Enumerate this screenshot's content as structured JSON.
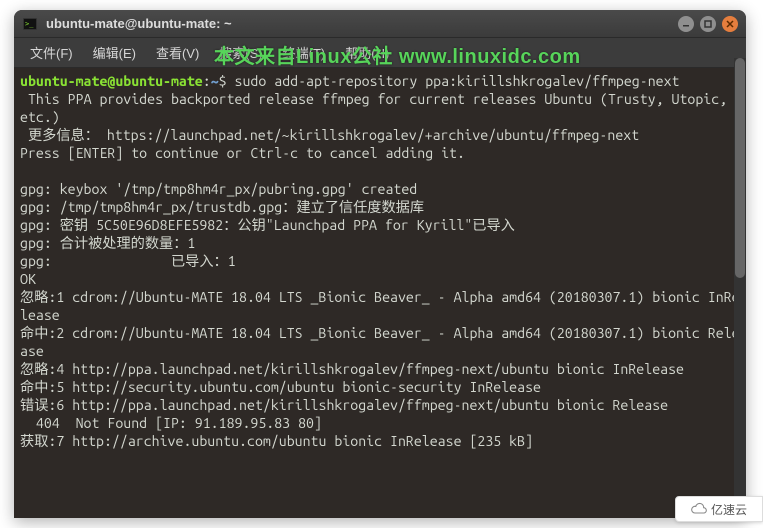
{
  "window": {
    "title": "ubuntu-mate@ubuntu-mate: ~"
  },
  "menubar": {
    "file": "文件(F)",
    "edit": "编辑(E)",
    "view": "查看(V)",
    "search": "搜索(S)",
    "terminal": "终端(T)",
    "help": "帮助(H)"
  },
  "watermark": "本文来自Linux公社 www.linuxidc.com",
  "prompt": {
    "user_host": "ubuntu-mate@ubuntu-mate",
    "colon": ":",
    "path": "~",
    "dollar": "$ "
  },
  "command": "sudo add-apt-repository ppa:kirillshkrogalev/ffmpeg-next",
  "output_lines": [
    " This PPA provides backported release ffmpeg for current releases Ubuntu (Trusty, Utopic, etc.)",
    " 更多信息： https://launchpad.net/~kirillshkrogalev/+archive/ubuntu/ffmpeg-next",
    "Press [ENTER] to continue or Ctrl-c to cancel adding it.",
    "",
    "gpg: keybox '/tmp/tmp8hm4r_px/pubring.gpg' created",
    "gpg: /tmp/tmp8hm4r_px/trustdb.gpg：建立了信任度数据库",
    "gpg: 密钥 5C50E96D8EFE5982：公钥\"Launchpad PPA for Kyrill\"已导入",
    "gpg: 合计被处理的数量：1",
    "gpg:               已导入：1",
    "OK",
    "忽略:1 cdrom://Ubuntu-MATE 18.04 LTS _Bionic Beaver_ - Alpha amd64 (20180307.1) bionic InRelease",
    "命中:2 cdrom://Ubuntu-MATE 18.04 LTS _Bionic Beaver_ - Alpha amd64 (20180307.1) bionic Release",
    "忽略:4 http://ppa.launchpad.net/kirillshkrogalev/ffmpeg-next/ubuntu bionic InRelease",
    "命中:5 http://security.ubuntu.com/ubuntu bionic-security InRelease",
    "错误:6 http://ppa.launchpad.net/kirillshkrogalev/ffmpeg-next/ubuntu bionic Release",
    "  404  Not Found [IP: 91.189.95.83 80]",
    "获取:7 http://archive.ubuntu.com/ubuntu bionic InRelease [235 kB]"
  ],
  "badge": {
    "text": "亿速云"
  }
}
